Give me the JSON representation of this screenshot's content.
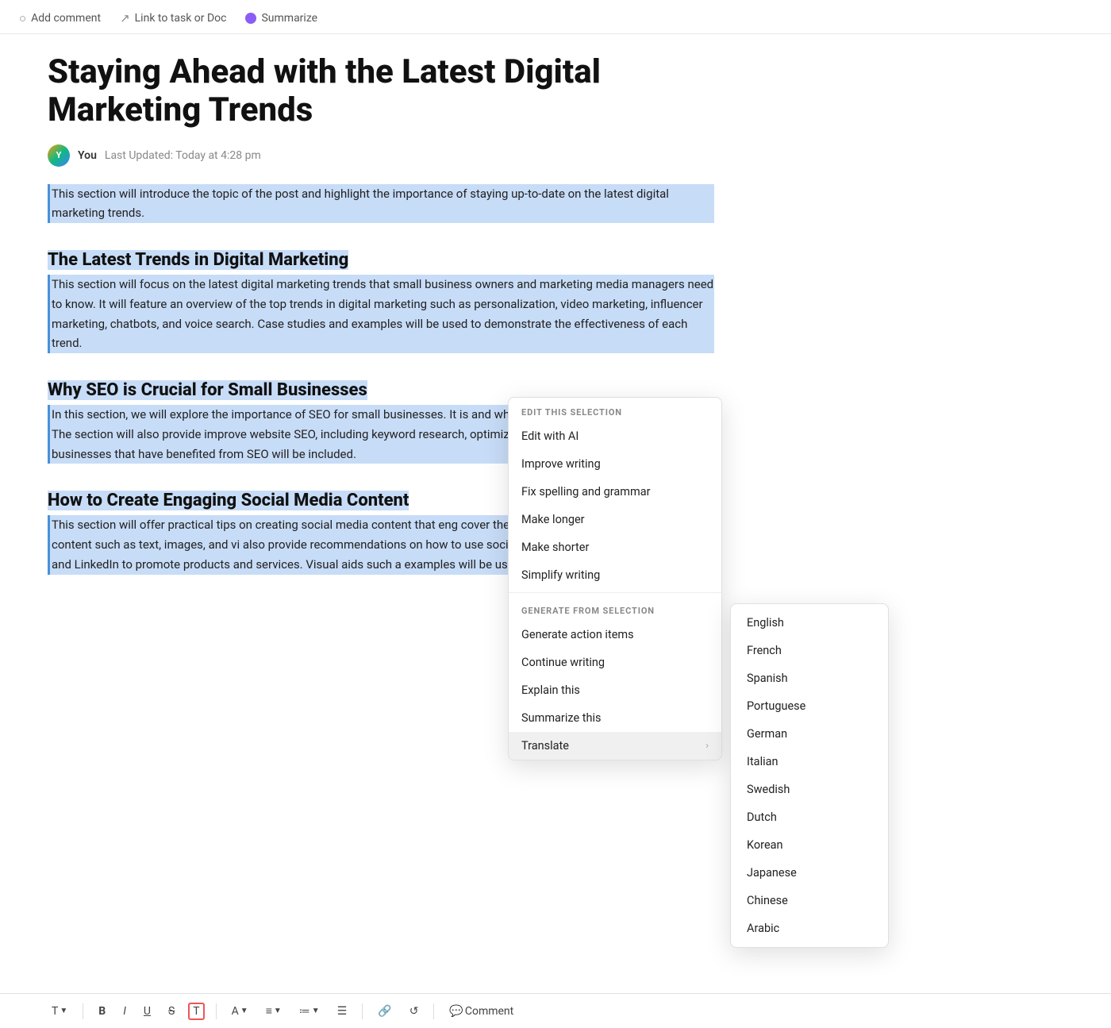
{
  "toolbar_top": {
    "items": [
      {
        "id": "add-comment",
        "icon": "comment-icon",
        "label": "Add comment"
      },
      {
        "id": "link-task",
        "icon": "link-icon",
        "label": "Link to task or Doc"
      },
      {
        "id": "summarize",
        "icon": "summarize-icon",
        "label": "Summarize"
      }
    ]
  },
  "doc": {
    "title": "Staying Ahead with the Latest Digital Marketing Trends",
    "author": "You",
    "last_updated": "Last Updated: Today at 4:28 pm",
    "sections": [
      {
        "id": "intro",
        "heading": null,
        "body": "This section will introduce the topic of the post and highlight the importance of staying up-to-date on the latest digital marketing trends.",
        "selected": true
      },
      {
        "id": "latest-trends",
        "heading": "The Latest Trends in Digital Marketing",
        "body": "This section will focus on the latest digital marketing trends that small business owners and marketing media managers need to know. It will feature an overview of the top trends in digital marketing such as personalization, video marketing, influencer marketing, chatbots, and voice search. Case studies and examples will be used to demonstrate the effectiveness of each trend.",
        "selected": true
      },
      {
        "id": "seo",
        "heading": "Why SEO is Crucial for Small Businesses",
        "body": "In this section, we will explore the importance of SEO for small businesses. It is and why it matters for small business owners. The section will also provide improve website SEO, including keyword research, optimizing content, and b Examples of small businesses that have benefited from SEO will be included.",
        "selected": true
      },
      {
        "id": "social-media",
        "heading": "How to Create Engaging Social Media Content",
        "body": "This section will offer practical tips on creating social media content that eng cover the different types of social media content such as text, images, and vi also provide recommendations on how to use social media platforms like Fac Instagram, and LinkedIn to promote products and services. Visual aids such a examples will be used to illustrate the best practices.",
        "selected": true
      }
    ]
  },
  "context_menu": {
    "section1_label": "EDIT THIS SELECTION",
    "section1_items": [
      {
        "id": "edit-with-ai",
        "label": "Edit with AI"
      },
      {
        "id": "improve-writing",
        "label": "Improve writing"
      },
      {
        "id": "fix-spelling",
        "label": "Fix spelling and grammar"
      },
      {
        "id": "make-longer",
        "label": "Make longer"
      },
      {
        "id": "make-shorter",
        "label": "Make shorter"
      },
      {
        "id": "simplify-writing",
        "label": "Simplify writing"
      }
    ],
    "section2_label": "GENERATE FROM SELECTION",
    "section2_items": [
      {
        "id": "generate-action-items",
        "label": "Generate action items"
      },
      {
        "id": "continue-writing",
        "label": "Continue writing"
      },
      {
        "id": "explain-this",
        "label": "Explain this"
      },
      {
        "id": "summarize-this",
        "label": "Summarize this"
      },
      {
        "id": "translate",
        "label": "Translate",
        "has_submenu": true
      }
    ]
  },
  "language_submenu": {
    "languages": [
      "English",
      "French",
      "Spanish",
      "Portuguese",
      "German",
      "Italian",
      "Swedish",
      "Dutch",
      "Korean",
      "Japanese",
      "Chinese",
      "Arabic"
    ]
  },
  "formatting_toolbar": {
    "items": [
      {
        "id": "text-style",
        "label": "T",
        "has_dropdown": true
      },
      {
        "id": "bold",
        "label": "B",
        "style": "bold"
      },
      {
        "id": "italic",
        "label": "I",
        "style": "italic"
      },
      {
        "id": "underline",
        "label": "U",
        "style": "underline"
      },
      {
        "id": "strikethrough",
        "label": "S",
        "style": "strike"
      },
      {
        "id": "code-block",
        "label": "⊡"
      },
      {
        "id": "color",
        "label": "A",
        "has_dropdown": true
      },
      {
        "id": "align",
        "label": "≡",
        "has_dropdown": true
      },
      {
        "id": "list",
        "label": "≔",
        "has_dropdown": true
      },
      {
        "id": "checklist",
        "label": "☰"
      },
      {
        "id": "link",
        "label": "🔗"
      },
      {
        "id": "undo",
        "label": "↺"
      },
      {
        "id": "comment",
        "label": "💬 Comment"
      }
    ]
  }
}
